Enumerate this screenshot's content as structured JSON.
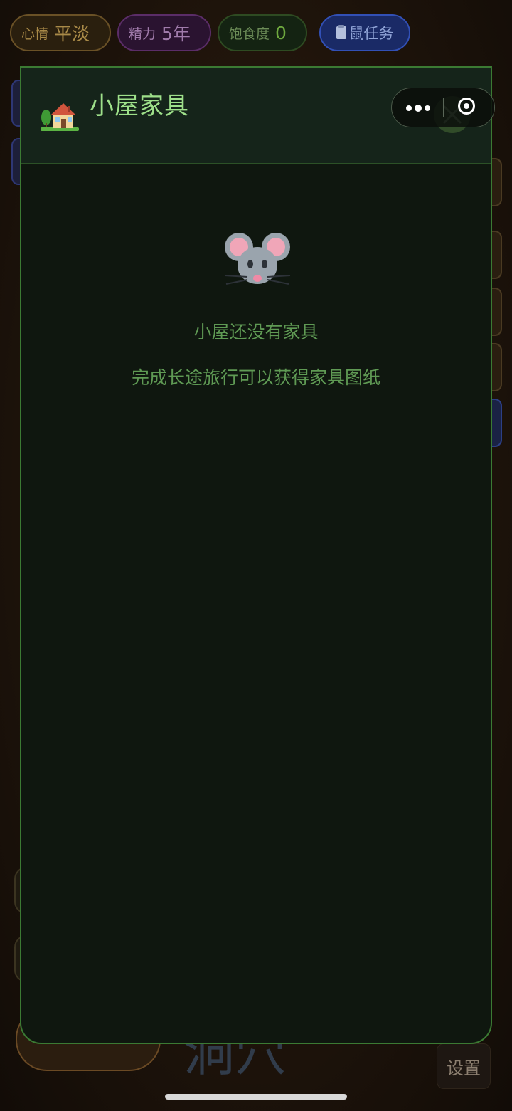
{
  "status": {
    "mood": {
      "label": "心情",
      "value": "平淡"
    },
    "energy": {
      "label": "精力",
      "value": "5年"
    },
    "satiety": {
      "label": "饱食度",
      "value": "0"
    },
    "task_button": "鼠任务"
  },
  "panel": {
    "title": "小屋家具",
    "empty_title": "小屋还没有家具",
    "empty_hint": "完成长途旅行可以获得家具图纸"
  },
  "background": {
    "cave_text": "洞穴",
    "settings_label": "设置"
  },
  "icons": {
    "header": "house-with-garden-icon",
    "empty_state": "mouse-face-icon",
    "close": "close-icon",
    "task": "clipboard-icon",
    "capsule_more": "more-dots-icon",
    "capsule_close": "target-icon"
  },
  "colors": {
    "panel_border": "#3b7a33",
    "title_green": "#9ee08a",
    "text_green": "#5f9a54"
  }
}
